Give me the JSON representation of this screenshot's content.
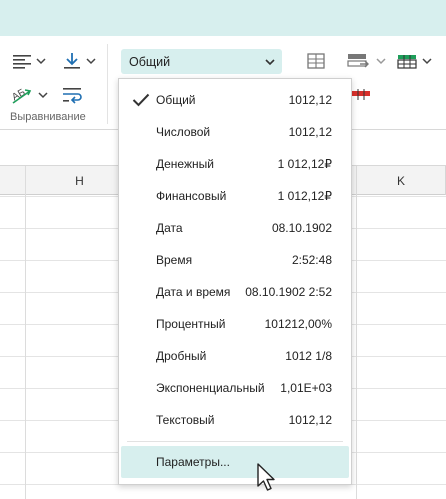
{
  "ribbon": {
    "alignment_group_label": "Выравнивание",
    "number_format_selected": "Общий"
  },
  "columns": {
    "h": "H",
    "k": "K"
  },
  "format_menu": {
    "items": [
      {
        "name": "Общий",
        "example": "1012,12",
        "checked": true
      },
      {
        "name": "Числовой",
        "example": "1012,12",
        "checked": false
      },
      {
        "name": "Денежный",
        "example": "1 012,12₽",
        "checked": false
      },
      {
        "name": "Финансовый",
        "example": "1 012,12₽",
        "checked": false
      },
      {
        "name": "Дата",
        "example": "08.10.1902",
        "checked": false
      },
      {
        "name": "Время",
        "example": "2:52:48",
        "checked": false
      },
      {
        "name": "Дата и время",
        "example": "08.10.1902 2:52",
        "checked": false
      },
      {
        "name": "Процентный",
        "example": "101212,00%",
        "checked": false
      },
      {
        "name": "Дробный",
        "example": "1012 1/8",
        "checked": false
      },
      {
        "name": "Экспоненциальный",
        "example": "1,01E+03",
        "checked": false
      },
      {
        "name": "Текстовый",
        "example": "1012,12",
        "checked": false
      }
    ],
    "parameters_label": "Параметры..."
  },
  "colors": {
    "accent": "#d7efee",
    "icon_blue": "#1f6fb2",
    "icon_green": "#1e9e5a",
    "icon_red": "#d9302b"
  }
}
